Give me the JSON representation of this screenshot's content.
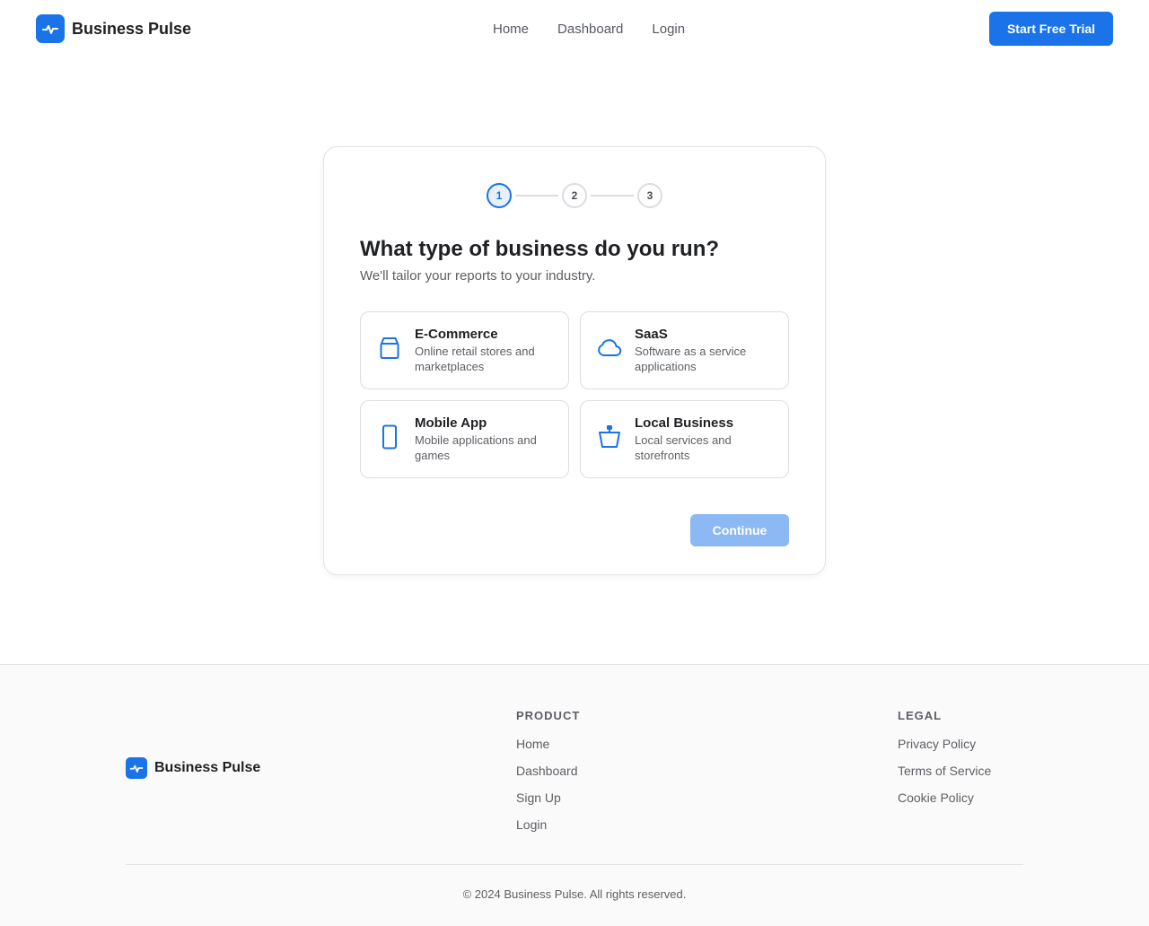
{
  "header": {
    "brand_name": "Business Pulse",
    "nav": [
      "Home",
      "Dashboard",
      "Login"
    ],
    "cta_label": "Start Free Trial"
  },
  "onboarding": {
    "steps": [
      "1",
      "2",
      "3"
    ],
    "current_step": 1,
    "title": "What type of business do you run?",
    "subtitle": "We'll tailor your reports to your industry.",
    "options": [
      {
        "name": "E-Commerce",
        "description": "Online retail stores and marketplaces",
        "icon": "store-icon"
      },
      {
        "name": "SaaS",
        "description": "Software as a service applications",
        "icon": "cloud-icon"
      },
      {
        "name": "Mobile App",
        "description": "Mobile applications and games",
        "icon": "smartphone-icon"
      },
      {
        "name": "Local Business",
        "description": "Local services and storefronts",
        "icon": "shopping-basket-icon"
      }
    ],
    "continue_label": "Continue"
  },
  "footer": {
    "brand_name": "Business Pulse",
    "product": {
      "heading": "PRODUCT",
      "links": [
        "Home",
        "Dashboard",
        "Sign Up",
        "Login"
      ]
    },
    "legal": {
      "heading": "LEGAL",
      "links": [
        "Privacy Policy",
        "Terms of Service",
        "Cookie Policy"
      ]
    },
    "copyright": "© 2024 Business Pulse. All rights reserved."
  },
  "colors": {
    "accent": "#1a73e8",
    "accent_disabled": "#8cb8f3"
  }
}
